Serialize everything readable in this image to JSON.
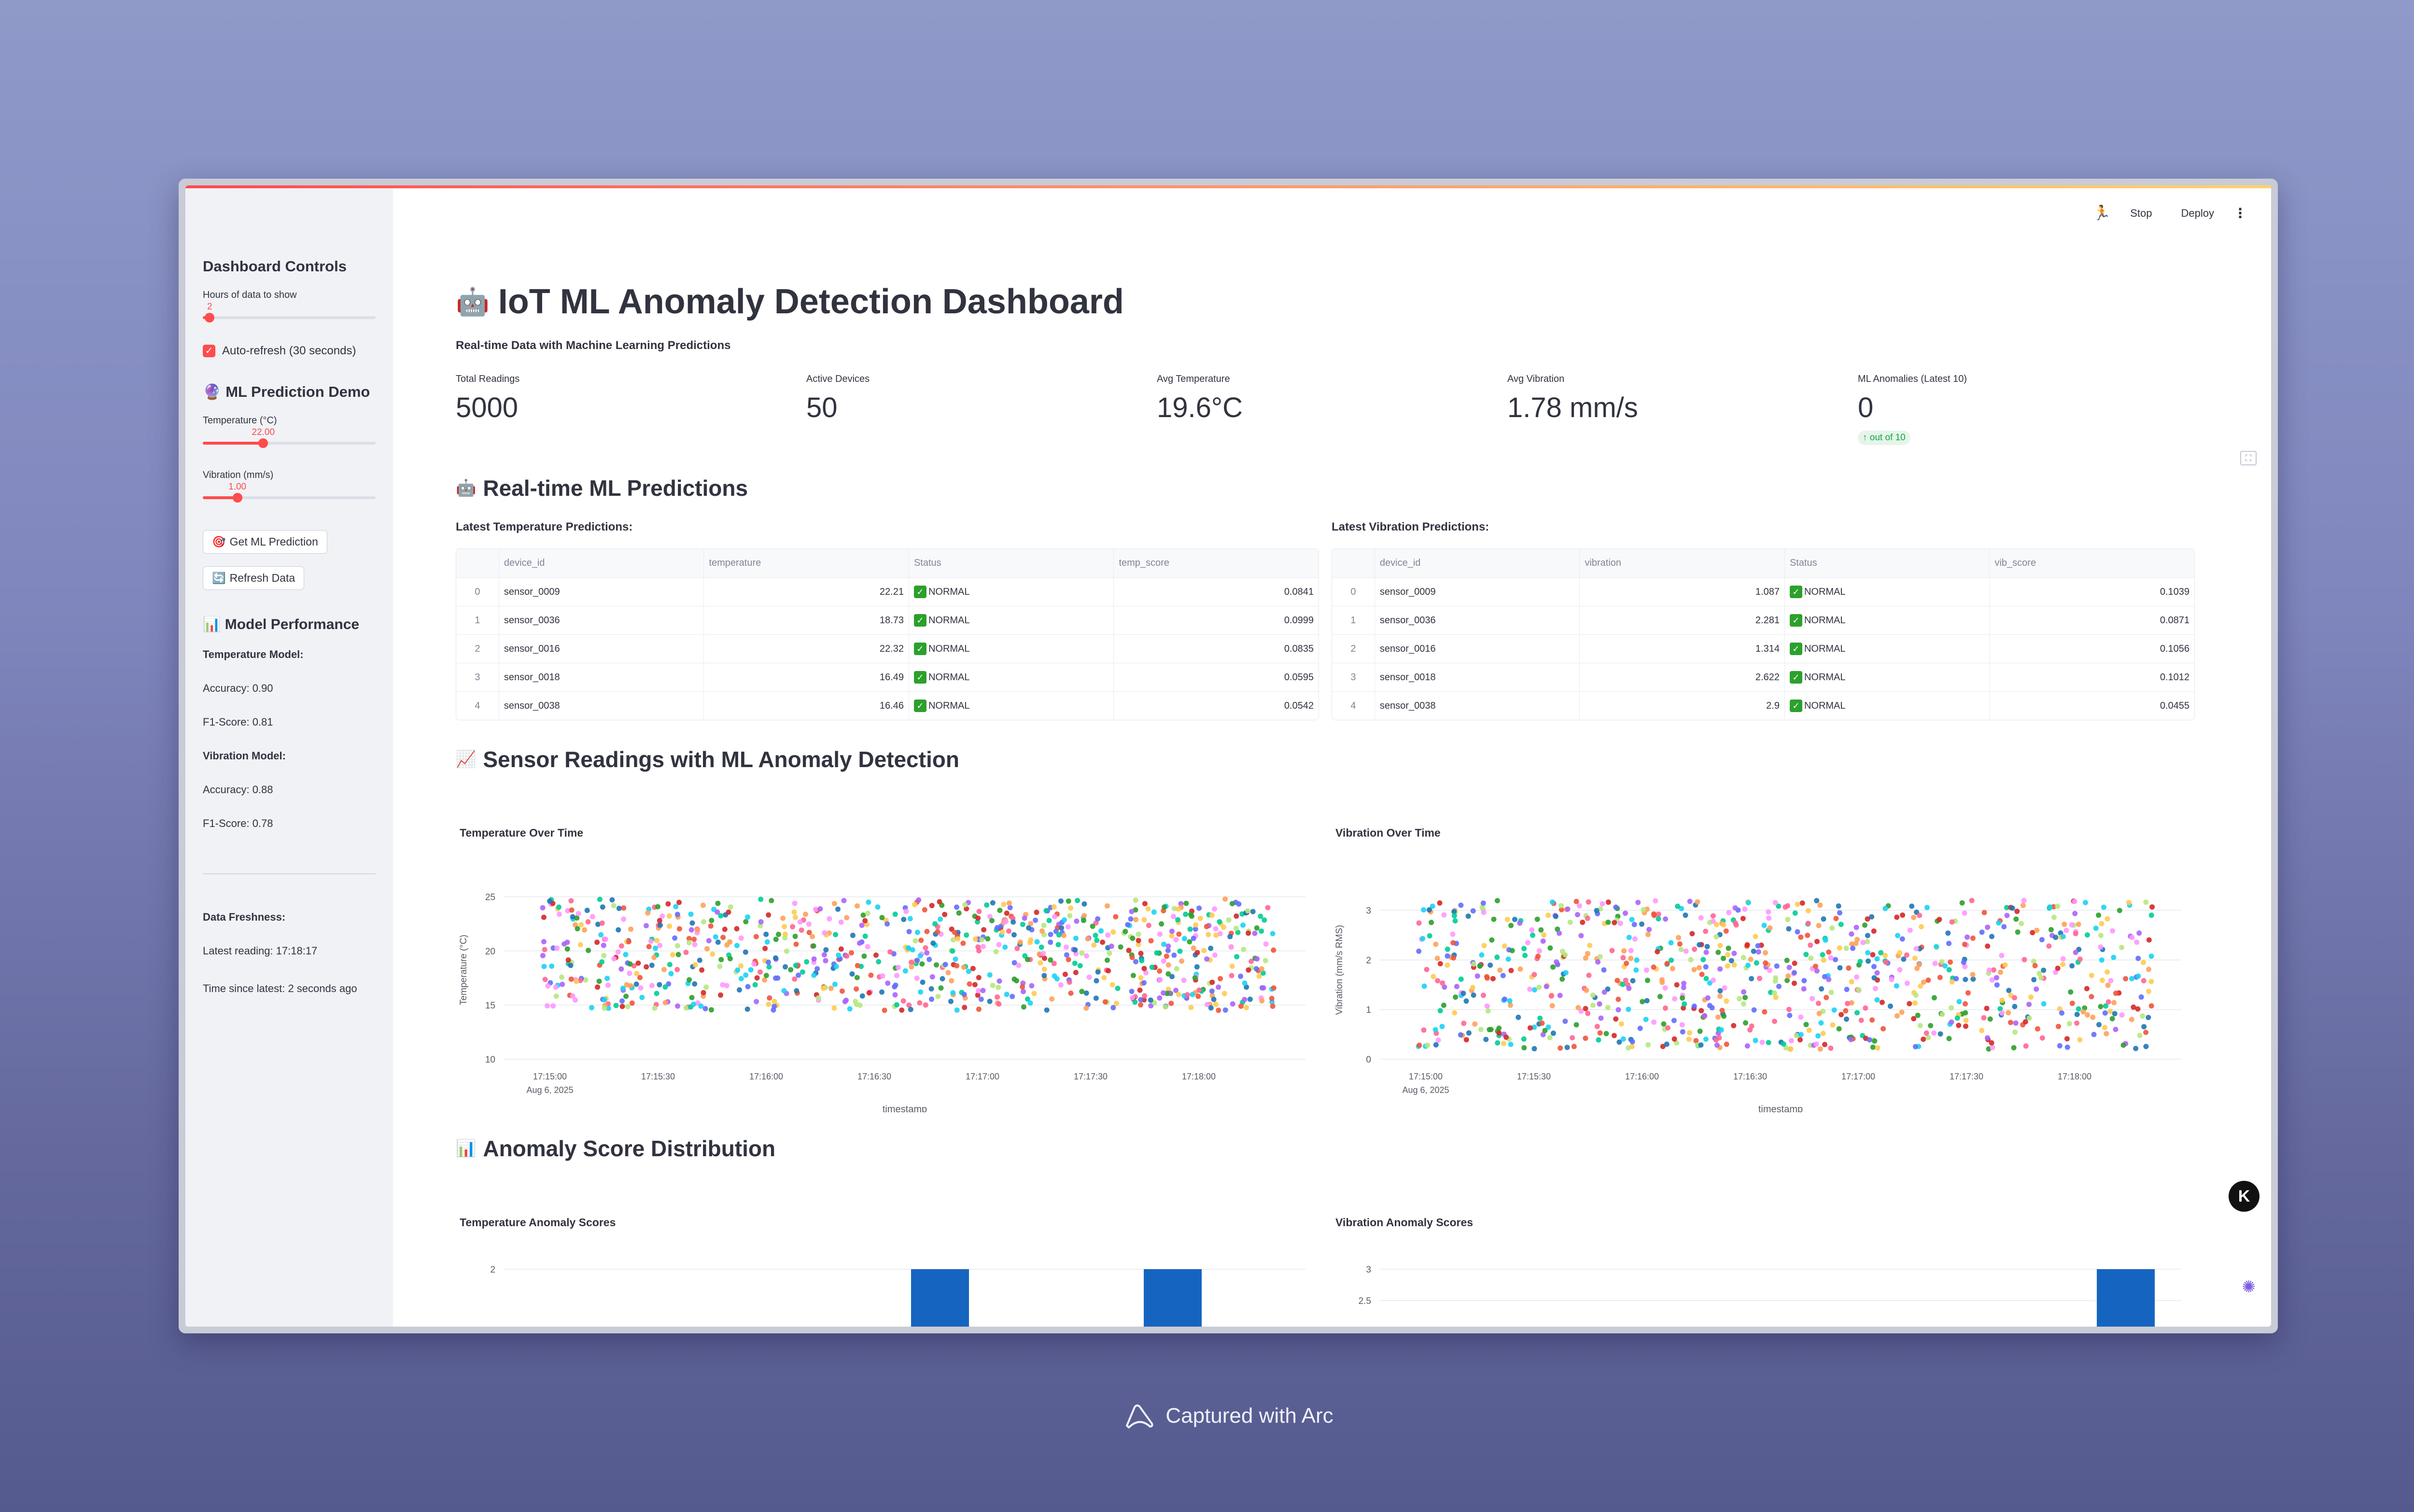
{
  "header": {
    "stop": "Stop",
    "deploy": "Deploy"
  },
  "sidebar": {
    "controls_title": "Dashboard Controls",
    "hours_label": "Hours of data to show",
    "hours_value": "2",
    "hours_fraction": 0.04,
    "autorefresh_label": "Auto-refresh (30 seconds)",
    "demo_title": "ML Prediction Demo",
    "temp_label": "Temperature (°C)",
    "temp_value": "22.00",
    "temp_fraction": 0.35,
    "vib_label": "Vibration (mm/s)",
    "vib_value": "1.00",
    "vib_fraction": 0.2,
    "predict_button": "Get ML Prediction",
    "refresh_button": "Refresh Data",
    "perf_title": "Model Performance",
    "temp_model": "Temperature Model:",
    "temp_acc": "Accuracy: 0.90",
    "temp_f1": "F1-Score: 0.81",
    "vib_model": "Vibration Model:",
    "vib_acc": "Accuracy: 0.88",
    "vib_f1": "F1-Score: 0.78",
    "fresh_title": "Data Freshness:",
    "latest_reading": "Latest reading: 17:18:17",
    "time_since": "Time since latest: 2 seconds ago"
  },
  "main": {
    "title": "IoT ML Anomaly Detection Dashboard",
    "subtitle": "Real-time Data with Machine Learning Predictions",
    "metrics": [
      {
        "label": "Total Readings",
        "value": "5000"
      },
      {
        "label": "Active Devices",
        "value": "50"
      },
      {
        "label": "Avg Temperature",
        "value": "19.6°C"
      },
      {
        "label": "Avg Vibration",
        "value": "1.78 mm/s"
      },
      {
        "label": "ML Anomalies (Latest 10)",
        "value": "0",
        "delta": "out of 10"
      }
    ],
    "predictions_title": "Real-time ML Predictions",
    "temp_table_title": "Latest Temperature Predictions:",
    "vib_table_title": "Latest Vibration Predictions:",
    "temp_table": {
      "headers": [
        "",
        "device_id",
        "temperature",
        "Status",
        "temp_score"
      ],
      "rows": [
        [
          "0",
          "sensor_0009",
          "22.21",
          "NORMAL",
          "0.0841"
        ],
        [
          "1",
          "sensor_0036",
          "18.73",
          "NORMAL",
          "0.0999"
        ],
        [
          "2",
          "sensor_0016",
          "22.32",
          "NORMAL",
          "0.0835"
        ],
        [
          "3",
          "sensor_0018",
          "16.49",
          "NORMAL",
          "0.0595"
        ],
        [
          "4",
          "sensor_0038",
          "16.46",
          "NORMAL",
          "0.0542"
        ]
      ]
    },
    "vib_table": {
      "headers": [
        "",
        "device_id",
        "vibration",
        "Status",
        "vib_score"
      ],
      "rows": [
        [
          "0",
          "sensor_0009",
          "1.087",
          "NORMAL",
          "0.1039"
        ],
        [
          "1",
          "sensor_0036",
          "2.281",
          "NORMAL",
          "0.0871"
        ],
        [
          "2",
          "sensor_0016",
          "1.314",
          "NORMAL",
          "0.1056"
        ],
        [
          "3",
          "sensor_0018",
          "2.622",
          "NORMAL",
          "0.1012"
        ],
        [
          "4",
          "sensor_0038",
          "2.9",
          "NORMAL",
          "0.0455"
        ]
      ]
    },
    "sensor_title": "Sensor Readings with ML Anomaly Detection",
    "dist_title": "Anomaly Score Distribution"
  },
  "chart_data": [
    {
      "type": "scatter",
      "title": "Temperature Over Time",
      "xlabel": "timestamp",
      "ylabel": "Temperature (°C)",
      "x_ticks": [
        "17:15:00",
        "17:15:30",
        "17:16:00",
        "17:16:30",
        "17:17:00",
        "17:17:30",
        "17:18:00"
      ],
      "x_sub": "Aug 6, 2025",
      "y_ticks": [
        10,
        15,
        20,
        25
      ],
      "ylim": [
        10,
        26.5
      ],
      "xlim": [
        "17:14:58",
        "17:18:19"
      ],
      "point_count": 900,
      "y_mean": 19.6,
      "y_spread": [
        14.5,
        24.8
      ]
    },
    {
      "type": "scatter",
      "title": "Vibration Over Time",
      "xlabel": "timestamp",
      "ylabel": "Vibration (mm/s RMS)",
      "x_ticks": [
        "17:15:00",
        "17:15:30",
        "17:16:00",
        "17:16:30",
        "17:17:00",
        "17:17:30",
        "17:18:00"
      ],
      "x_sub": "Aug 6, 2025",
      "y_ticks": [
        0,
        1,
        2,
        3
      ],
      "ylim": [
        0,
        3.6
      ],
      "xlim": [
        "17:14:58",
        "17:18:19"
      ],
      "point_count": 900,
      "y_spread": [
        0.2,
        3.2
      ]
    },
    {
      "type": "bar",
      "title": "Temperature Anomaly Scores",
      "y_ticks": [
        2
      ],
      "visible_bars": [
        2,
        2
      ]
    },
    {
      "type": "bar",
      "title": "Vibration Anomaly Scores",
      "y_ticks": [
        2.5,
        3
      ],
      "visible_bars": [
        3
      ]
    }
  ],
  "colors": {
    "accent": "#ff4b4b",
    "bar": "#1565c0",
    "normal": "#2ca02c",
    "palette": [
      "#636efa",
      "#ef553b",
      "#00cc96",
      "#ab63fa",
      "#ffa15a",
      "#19d3f3",
      "#ff6692",
      "#b6e880",
      "#ff97ff",
      "#fecb52",
      "#1f77b4",
      "#d62728",
      "#2ca02c"
    ]
  },
  "footer": "Captured with Arc"
}
